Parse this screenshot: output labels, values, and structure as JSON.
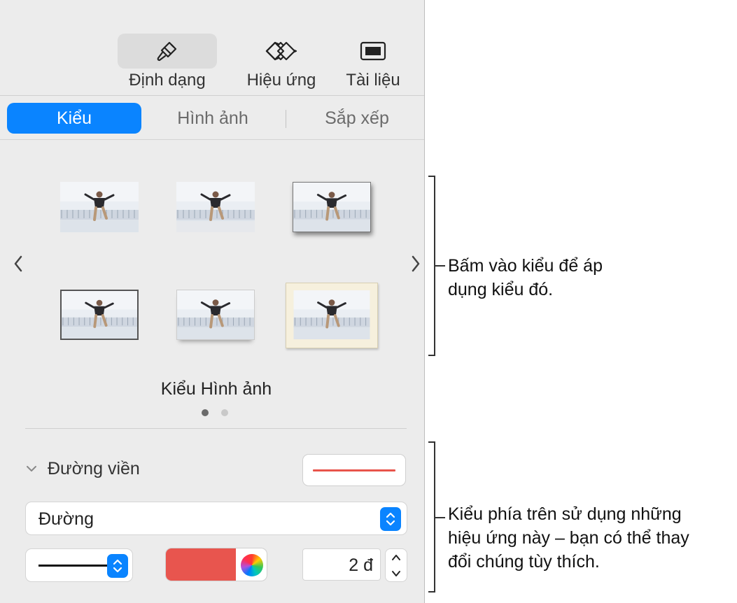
{
  "toolbar": {
    "format": {
      "label": "Định dạng",
      "icon": "paintbrush-icon"
    },
    "effects": {
      "label": "Hiệu ứng",
      "icon": "diamond-icon"
    },
    "document": {
      "label": "Tài liệu",
      "icon": "document-icon"
    }
  },
  "tabs": [
    "Kiểu",
    "Hình ảnh",
    "Sắp xếp"
  ],
  "active_tab": "Kiểu",
  "styles": {
    "title": "Kiểu Hình ảnh",
    "thumbnails": [
      {
        "id": "style-1",
        "frame": "none"
      },
      {
        "id": "style-2",
        "frame": "reflection"
      },
      {
        "id": "style-3",
        "frame": "shadow"
      },
      {
        "id": "style-4",
        "frame": "thin-border"
      },
      {
        "id": "style-5",
        "frame": "curved-shadow"
      },
      {
        "id": "style-6",
        "frame": "cream-mat"
      }
    ],
    "page_count": 2,
    "current_page": 1
  },
  "border": {
    "label": "Đường viền",
    "type": "Đường",
    "color": "#e8554e",
    "width": "2 đ"
  },
  "callouts": {
    "styles_note": [
      "Bấm vào kiểu để áp",
      "dụng kiểu đó."
    ],
    "border_note": [
      "Kiểu phía trên sử dụng những",
      "hiệu ứng này – bạn có thể thay",
      "đổi chúng tùy thích."
    ]
  }
}
